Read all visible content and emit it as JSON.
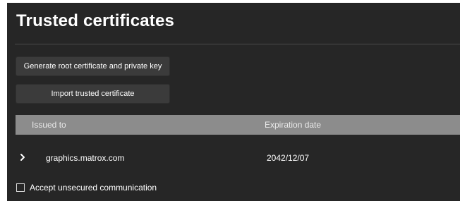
{
  "title": "Trusted certificates",
  "buttons": {
    "generate": "Generate root certificate and private key",
    "import": "Import trusted certificate"
  },
  "table": {
    "columns": [
      "Issued to",
      "Expiration date"
    ],
    "rows": [
      {
        "issued_to": "graphics.matrox.com",
        "expiration": "2042/12/07",
        "expanded": false
      }
    ]
  },
  "accept_unsecured": {
    "label": "Accept unsecured communication",
    "checked": false
  }
}
